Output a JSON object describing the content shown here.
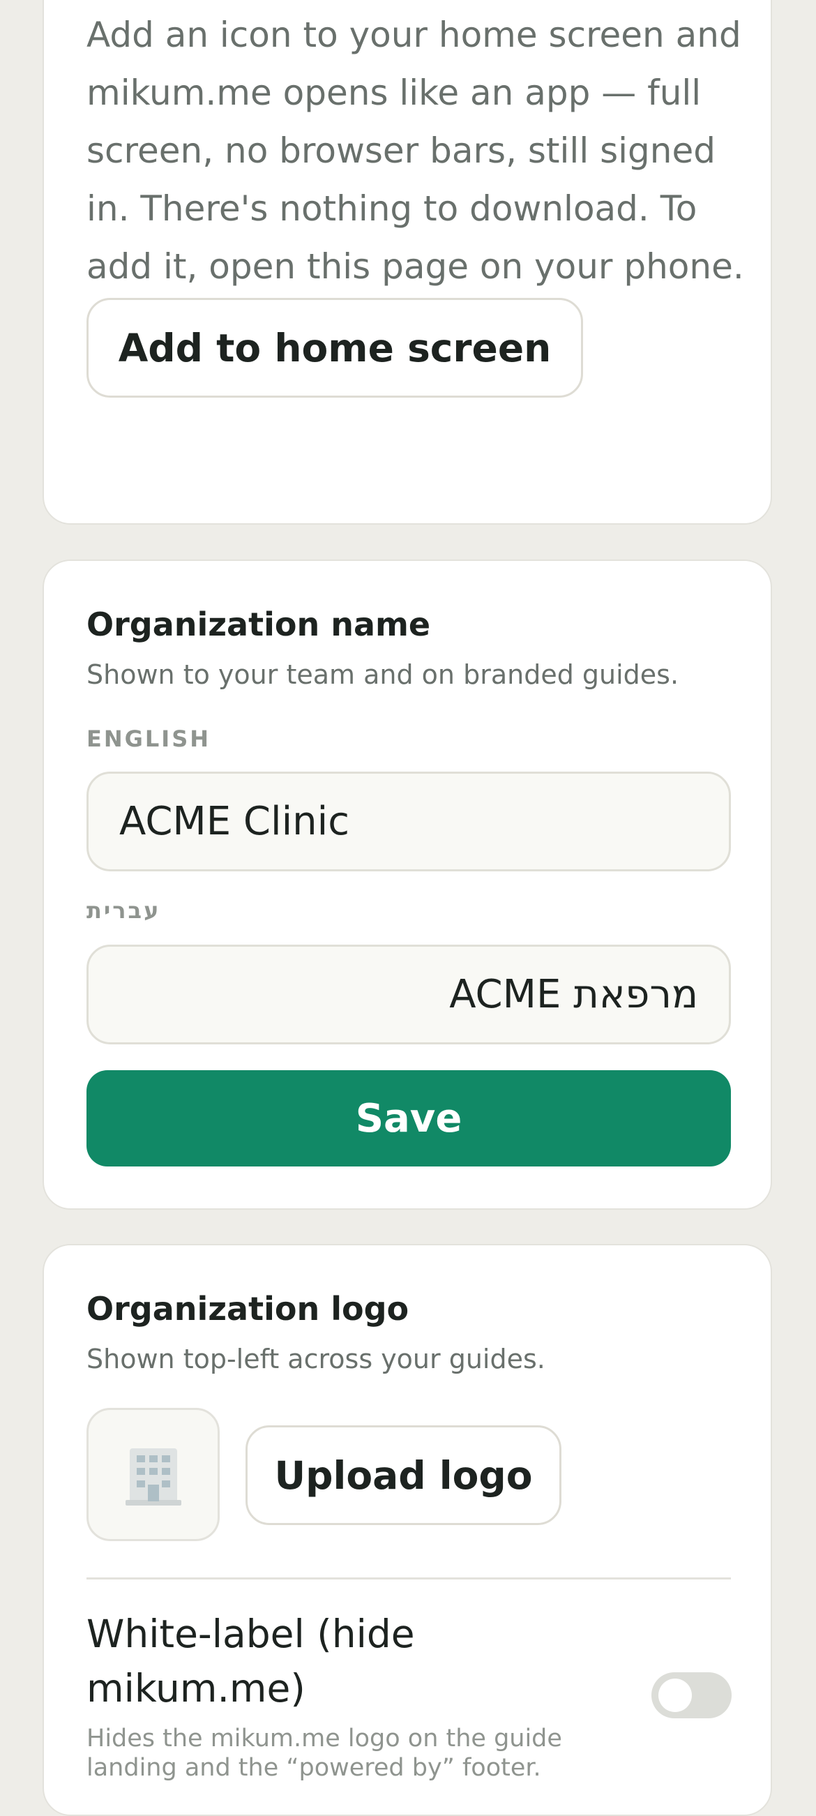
{
  "install": {
    "description": "Add an icon to your home screen and mikum.me opens like an app — full screen, no browser bars, still signed in. There's nothing to download. To add it, open this page on your phone.",
    "button_label": "Add to home screen"
  },
  "org_name": {
    "title": "Organization name",
    "subtitle": "Shown to your team and on branded guides.",
    "english_label": "ENGLISH",
    "english_value": "ACME Clinic",
    "hebrew_label": "עברית",
    "hebrew_value": "מרפאת ACME",
    "save_label": "Save"
  },
  "org_logo": {
    "title": "Organization logo",
    "subtitle": "Shown top-left across your guides.",
    "placeholder_icon": "building-icon",
    "upload_label": "Upload logo"
  },
  "white_label": {
    "title": "White-label (hide mikum.me)",
    "description": "Hides the mikum.me logo on the guide landing and the “powered by” footer.",
    "enabled": false
  },
  "colors": {
    "accent": "#118966",
    "background": "#eeede8",
    "card": "#ffffff",
    "muted_text": "#69706c"
  }
}
